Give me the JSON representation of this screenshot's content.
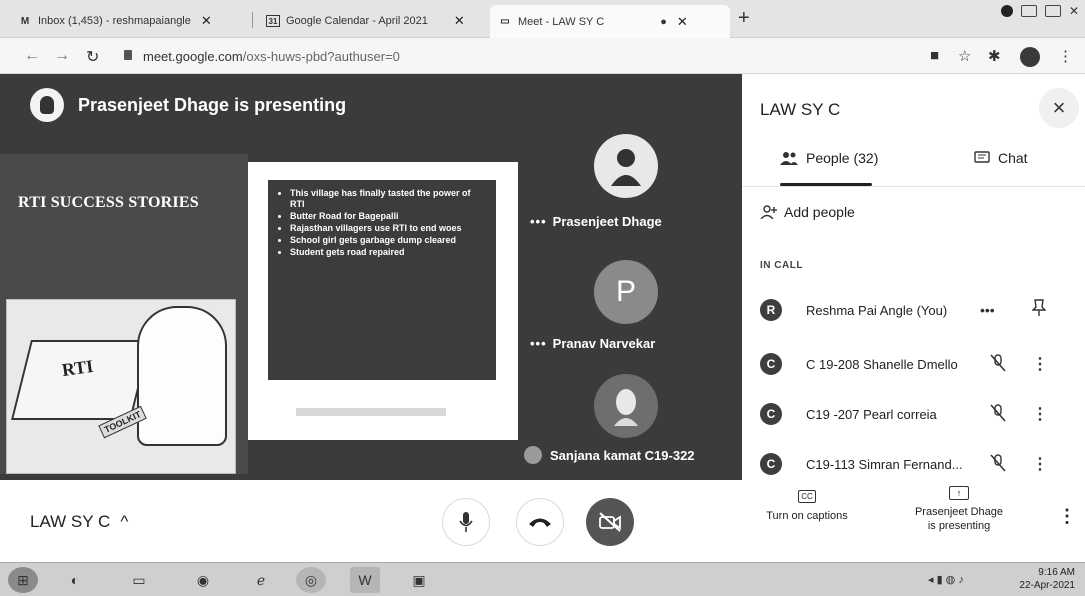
{
  "browser": {
    "tabs": [
      {
        "label": "Inbox (1,453) - reshmapaiangle",
        "icon": "gmail-icon"
      },
      {
        "label": "Google Calendar - April 2021",
        "icon": "calendar-icon"
      },
      {
        "label": "Meet - LAW SY C",
        "icon": "meet-icon",
        "active": true
      }
    ],
    "url_host": "meet.google.com",
    "url_path": "/oxs-huws-pbd?authuser=0"
  },
  "stage": {
    "presenter_banner": "Prasenjeet Dhage is presenting",
    "slide": {
      "title": "RTI SUCCESS STORIES",
      "bullets": [
        "This village has finally tasted the power of RTI",
        "Butter Road for Bagepalli",
        "Rajasthan villagers use RTI to end woes",
        "School girl gets garbage dump cleared",
        "Student gets road repaired"
      ],
      "image_label": "RTI",
      "image_tag": "TOOLKIT"
    },
    "tiles": [
      {
        "name": "Prasenjeet Dhage",
        "initial": ""
      },
      {
        "name": "Pranav Narvekar",
        "initial": "P"
      },
      {
        "name": "Sanjana kamat C19-322",
        "initial": ""
      }
    ]
  },
  "bottombar": {
    "meeting_name": "LAW SY C",
    "caret": "^"
  },
  "panel": {
    "title": "LAW SY C",
    "close": "×",
    "tab_people": "People (32)",
    "tab_chat": "Chat",
    "add_people": "Add people",
    "in_call": "IN CALL",
    "people": [
      {
        "initial": "R",
        "name": "Reshma Pai Angle (You)",
        "mid": "•••",
        "end": "pin-icon"
      },
      {
        "initial": "C",
        "name": "C 19-208 Shanelle Dmello",
        "mid": "muted-mic-icon",
        "end": "⋮"
      },
      {
        "initial": "C",
        "name": "C19 -207 Pearl correia",
        "mid": "muted-mic-icon",
        "end": "⋮"
      },
      {
        "initial": "C",
        "name": "C19-113 Simran Fernand...",
        "mid": "muted-mic-icon",
        "end": "⋮"
      }
    ],
    "captions_icon": "CC",
    "captions_label": "Turn on captions",
    "presenting_label_line1": "Prasenjeet Dhage",
    "presenting_label_line2": "is presenting",
    "more": "⋮"
  },
  "taskbar": {
    "time": "9:16 AM",
    "date": "22-Apr-2021"
  },
  "colors": {
    "stage_bg": "#3b3b3b",
    "cam_off_button": "#555555"
  }
}
